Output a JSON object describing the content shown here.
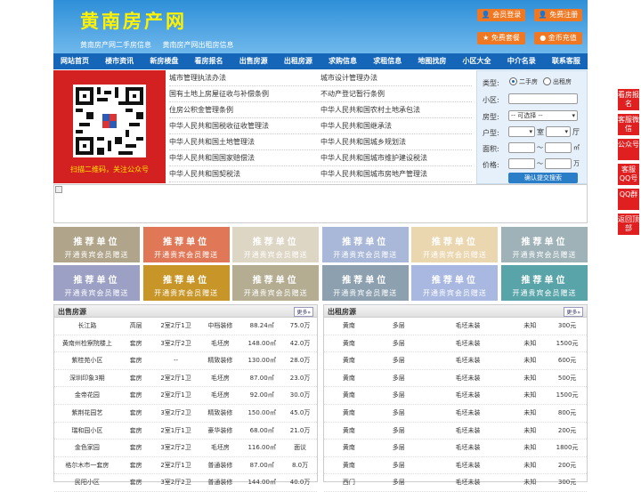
{
  "header": {
    "logo": "黄南房产网",
    "sublinks": [
      "黄南房产网二手房信息",
      "黄南房产网出租房信息"
    ],
    "buttons": [
      "会员登录",
      "免费注册",
      "免费套餐",
      "金币充值"
    ]
  },
  "nav": [
    "网站首页",
    "楼市资讯",
    "新房楼盘",
    "看房报名",
    "出售房源",
    "出租房源",
    "求购信息",
    "求租信息",
    "地图找房",
    "小区大全",
    "中介名录",
    "联系客服"
  ],
  "qr": {
    "caption": "扫描二维码，关注公众号"
  },
  "links": [
    [
      "城市管理执法办法",
      "城市设计管理办法"
    ],
    [
      "国有土地上房屋征收与补偿条例",
      "不动产登记暂行条例"
    ],
    [
      "住房公积金管理条例",
      "中华人民共和国农村土地承包法"
    ],
    [
      "中华人民共和国税收征收管理法",
      "中华人民共和国继承法"
    ],
    [
      "中华人民共和国土地管理法",
      "中华人民共和国城乡规划法"
    ],
    [
      "中华人民共和国国家赔偿法",
      "中华人民共和国城市维护建设税法"
    ],
    [
      "中华人民共和国契税法",
      "中华人民共和国城市房地产管理法"
    ]
  ],
  "search": {
    "type_label": "类型:",
    "opt1": "二手房",
    "opt2": "出租房",
    "community_label": "小区:",
    "housetype_label": "房型:",
    "housetype_value": "-- 可选择 --",
    "layout_label": "户型:",
    "room": "室",
    "hall": "厅",
    "area_label": "面积:",
    "area_sep": "〜",
    "area_unit": "㎡",
    "price_label": "价格:",
    "price_sep": "〜",
    "price_unit": "万",
    "submit": "确认提交搜索"
  },
  "tiles": {
    "line1": "推荐单位",
    "line2": "开通贵宾会员赠送",
    "colors": [
      "#b0a58a",
      "#e07858",
      "#ddd6c4",
      "#a9b8d8",
      "#ead7b0",
      "#9fb2b8",
      "#9ba0c4",
      "#c89628",
      "#b4ad92",
      "#8ca0b0",
      "#a9b8e0",
      "#58a4a8"
    ]
  },
  "sale": {
    "title": "出售房源",
    "more": "更多»",
    "rows": [
      [
        "长江路",
        "高层",
        "2室2厅1卫",
        "中档装修",
        "88.24㎡",
        "75.0万"
      ],
      [
        "黄南州检察院楼上",
        "套房",
        "3室2厅2卫",
        "毛坯房",
        "148.00㎡",
        "42.0万"
      ],
      [
        "紫桂苑小区",
        "套房",
        "--",
        "精致装修",
        "130.00㎡",
        "28.0万"
      ],
      [
        "深圳印象3期",
        "套房",
        "2室2厅1卫",
        "毛坯房",
        "87.00㎡",
        "23.0万"
      ],
      [
        "金帝花园",
        "套房",
        "2室2厅1卫",
        "毛坯房",
        "92.00㎡",
        "30.0万"
      ],
      [
        "紫荆花园艺",
        "套房",
        "3室2厅2卫",
        "精致装修",
        "150.00㎡",
        "45.0万"
      ],
      [
        "瑞和园小区",
        "套房",
        "2室1厅1卫",
        "豪华装修",
        "68.00㎡",
        "21.0万"
      ],
      [
        "金色家园",
        "套房",
        "3室2厅2卫",
        "毛坯房",
        "116.00㎡",
        "面议"
      ],
      [
        "格尔木市一套房",
        "套房",
        "2室2厅1卫",
        "普通装修",
        "87.00㎡",
        "8.0万"
      ],
      [
        "民阳小区",
        "套房",
        "3室2厅2卫",
        "普通装修",
        "144.00㎡",
        "40.0万"
      ]
    ]
  },
  "rent": {
    "title": "出租房源",
    "more": "更多»",
    "rows": [
      [
        "黄南",
        "多层",
        "毛坯未装",
        "未知",
        "300元"
      ],
      [
        "黄南",
        "多层",
        "毛坯未装",
        "未知",
        "1500元"
      ],
      [
        "黄南",
        "多层",
        "毛坯未装",
        "未知",
        "600元"
      ],
      [
        "黄南",
        "多层",
        "毛坯未装",
        "未知",
        "500元"
      ],
      [
        "黄南",
        "多层",
        "毛坯未装",
        "未知",
        "1500元"
      ],
      [
        "黄南",
        "多层",
        "毛坯未装",
        "未知",
        "800元"
      ],
      [
        "黄南",
        "多层",
        "毛坯未装",
        "未知",
        "200元"
      ],
      [
        "黄南",
        "多层",
        "毛坯未装",
        "未知",
        "1800元"
      ],
      [
        "黄南",
        "多层",
        "毛坯未装",
        "未知",
        "200元"
      ],
      [
        "西门",
        "多层",
        "毛坯未装",
        "未知",
        "300元"
      ]
    ]
  },
  "side": [
    "看房报名",
    "客服微信",
    "公众号",
    "客服QQ号",
    "QQ群",
    "返回顶部"
  ]
}
